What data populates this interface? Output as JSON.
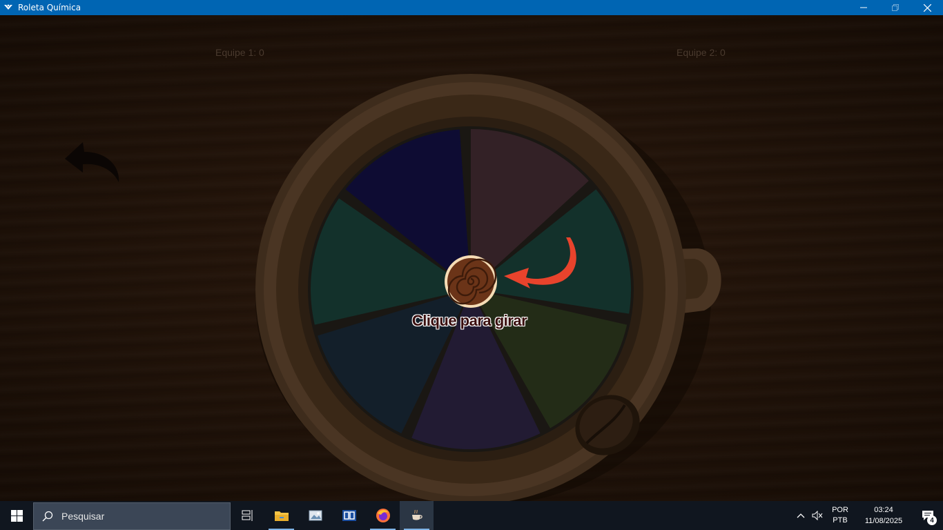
{
  "window": {
    "title": "Roleta Química",
    "icon": "app-logo-icon",
    "controls": [
      "minimize-icon",
      "restore-icon",
      "close-icon"
    ]
  },
  "game": {
    "team1_score": "Equipe 1: 0",
    "team2_score": "Equipe 2: 0",
    "spin_hint": "Clique para girar",
    "back_icon": "back-arrow-icon",
    "pointer_icon": "red-curved-arrow-icon",
    "wheel_colors": [
      "#332126",
      "#13312b",
      "#232c17",
      "#221b33",
      "#131f2a",
      "#13312b",
      "#0e0c33"
    ],
    "accent_color": "#e8432c"
  },
  "taskbar": {
    "search_placeholder": "Pesquisar",
    "apps": [
      "task-view-icon",
      "file-explorer-icon",
      "image-viewer-icon",
      "media-app-icon",
      "firefox-icon",
      "coffee-game-icon"
    ],
    "lang_line1": "POR",
    "lang_line2": "PTB",
    "time": "03:24",
    "date": "11/08/2025",
    "notification_count": "4"
  }
}
